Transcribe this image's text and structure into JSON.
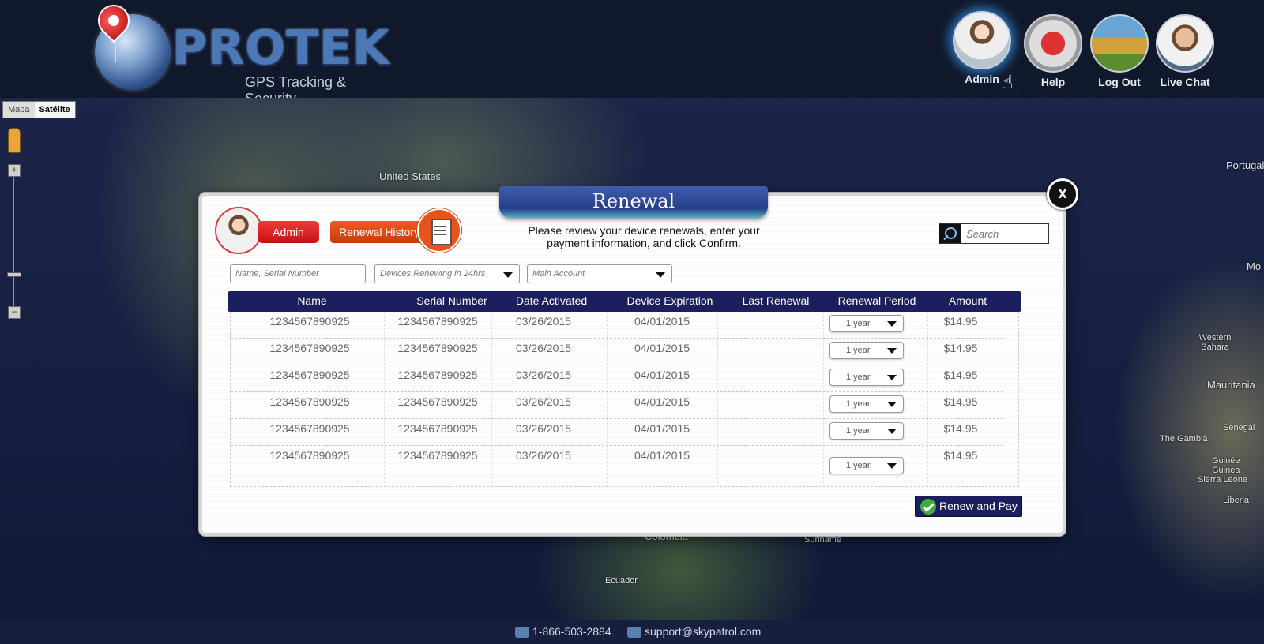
{
  "header": {
    "brand": "PROTEK",
    "tagline": "GPS Tracking & Security",
    "nav": [
      {
        "label": "Admin"
      },
      {
        "label": "Help"
      },
      {
        "label": "Log Out"
      },
      {
        "label": "Live Chat"
      }
    ]
  },
  "map": {
    "type_options": [
      "Mapa",
      "Satélite"
    ],
    "type_selected": "Satélite",
    "labels": [
      "United States",
      "Colombia",
      "Suriname",
      "Ecuador",
      "Portugal",
      "Mo",
      "Western Sahara",
      "Mauritania",
      "Senegal",
      "The Gambia",
      "Guinée Guinea",
      "Sierra Leone",
      "Liberia"
    ]
  },
  "modal": {
    "title": "Renewal",
    "close_label": "x",
    "user_badge": "Admin",
    "history_button": "Renewal History",
    "instructions": "Please review your device renewals, enter your payment information, and click Confirm.",
    "search_placeholder": "Search",
    "filters": {
      "name_placeholder": "Name, Serial Number",
      "renewing_selected": "Devices Renewing in 24hrs",
      "account_selected": "Main Account"
    },
    "columns": [
      "Name",
      "Serial Number",
      "Date Activated",
      "Device Expiration",
      "Last Renewal",
      "Renewal Period",
      "Amount"
    ],
    "rows": [
      {
        "name": "1234567890925",
        "serial": "1234567890925",
        "activated": "03/26/2015",
        "expiration": "04/01/2015",
        "last_renewal": "",
        "period": "1 year",
        "amount": "$14.95"
      },
      {
        "name": "1234567890925",
        "serial": "1234567890925",
        "activated": "03/26/2015",
        "expiration": "04/01/2015",
        "last_renewal": "",
        "period": "1 year",
        "amount": "$14.95"
      },
      {
        "name": "1234567890925",
        "serial": "1234567890925",
        "activated": "03/26/2015",
        "expiration": "04/01/2015",
        "last_renewal": "",
        "period": "1 year",
        "amount": "$14.95"
      },
      {
        "name": "1234567890925",
        "serial": "1234567890925",
        "activated": "03/26/2015",
        "expiration": "04/01/2015",
        "last_renewal": "",
        "period": "1 year",
        "amount": "$14.95"
      },
      {
        "name": "1234567890925",
        "serial": "1234567890925",
        "activated": "03/26/2015",
        "expiration": "04/01/2015",
        "last_renewal": "",
        "period": "1 year",
        "amount": "$14.95"
      },
      {
        "name": "1234567890925",
        "serial": "1234567890925",
        "activated": "03/26/2015",
        "expiration": "04/01/2015",
        "last_renewal": "",
        "period": "1 year",
        "amount": "$14.95"
      }
    ],
    "pay_button": "Renew and Pay"
  },
  "footer": {
    "phone": "1-866-503-2884",
    "email": "support@skypatrol.com"
  },
  "colors": {
    "table_header": "#1c1f5e",
    "admin_red": "#e02020",
    "history_orange": "#e8531c",
    "ribbon_blue": "#2a448f"
  }
}
